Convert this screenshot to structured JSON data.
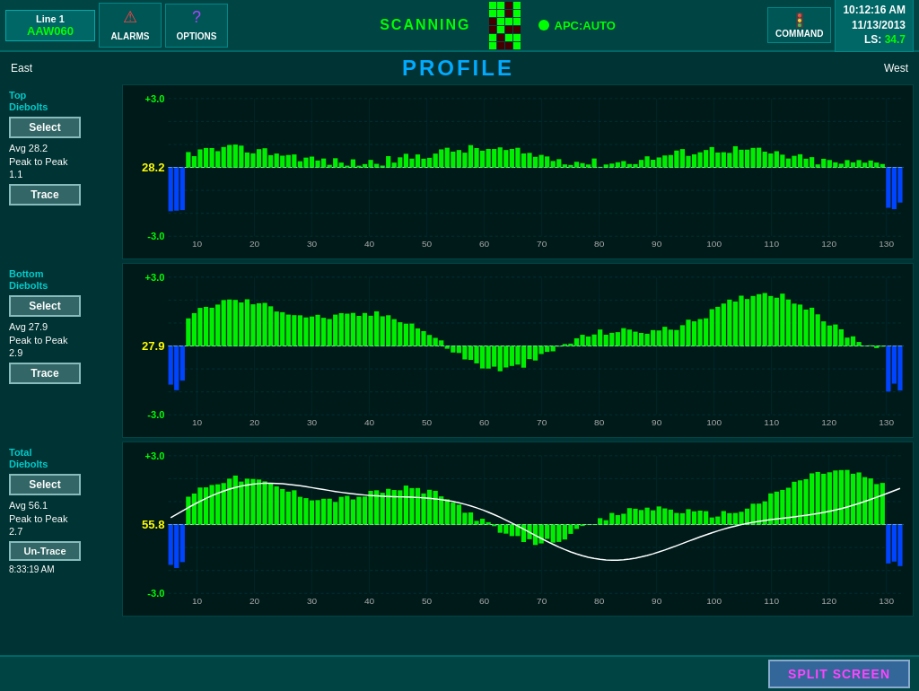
{
  "header": {
    "line_label": "Line 1",
    "line_id": "AAW060",
    "alarms_label": "ALARMS",
    "options_label": "OPTIONS",
    "scanning_label": "SCANNING",
    "apc_label": "APC:AUTO",
    "command_label": "COMMAND",
    "time": "10:12:16 AM",
    "date": "11/13/2013",
    "ls_label": "LS:",
    "ls_value": "34.7",
    "grid_pattern": [
      1,
      1,
      0,
      1,
      1,
      1,
      0,
      1,
      0,
      1,
      1,
      1,
      0,
      1,
      0,
      0,
      1,
      0,
      1,
      1,
      1,
      0,
      0,
      1
    ]
  },
  "page": {
    "east_label": "East",
    "west_label": "West",
    "title": "PROFILE"
  },
  "charts": [
    {
      "id": "top",
      "section_label": "Top\nDiebolts",
      "select_label": "Select",
      "avg_label": "Avg",
      "avg_value": "28.2",
      "avg_display": "28.2",
      "peak_to_peak_label": "Peak to Peak",
      "peak_to_peak_value": "1.1",
      "trace_label": "Trace",
      "y_max": "+3.0",
      "y_min": "-3.0",
      "x_ticks": [
        10,
        20,
        30,
        40,
        50,
        60,
        70,
        80,
        90,
        100,
        110,
        120,
        130
      ]
    },
    {
      "id": "bottom",
      "section_label": "Bottom\nDiebolts",
      "select_label": "Select",
      "avg_label": "Avg",
      "avg_value": "27.9",
      "avg_display": "27.9",
      "peak_to_peak_label": "Peak to Peak",
      "peak_to_peak_value": "2.9",
      "trace_label": "Trace",
      "y_max": "+3.0",
      "y_min": "-3.0",
      "x_ticks": [
        10,
        20,
        30,
        40,
        50,
        60,
        70,
        80,
        90,
        100,
        110,
        120,
        130
      ]
    },
    {
      "id": "total",
      "section_label": "Total\nDiebolts",
      "select_label": "Select",
      "avg_label": "Avg",
      "avg_value": "56.1",
      "avg_display": "55.8",
      "peak_to_peak_label": "Peak to Peak",
      "peak_to_peak_value": "2.7",
      "trace_label": "Un-Trace",
      "timestamp": "8:33:19 AM",
      "y_max": "+3.0",
      "y_min": "-3.0",
      "x_ticks": [
        10,
        20,
        30,
        40,
        50,
        60,
        70,
        80,
        90,
        100,
        110,
        120,
        130
      ]
    }
  ],
  "footer": {
    "split_screen_label": "SPLIT SCREEN"
  }
}
